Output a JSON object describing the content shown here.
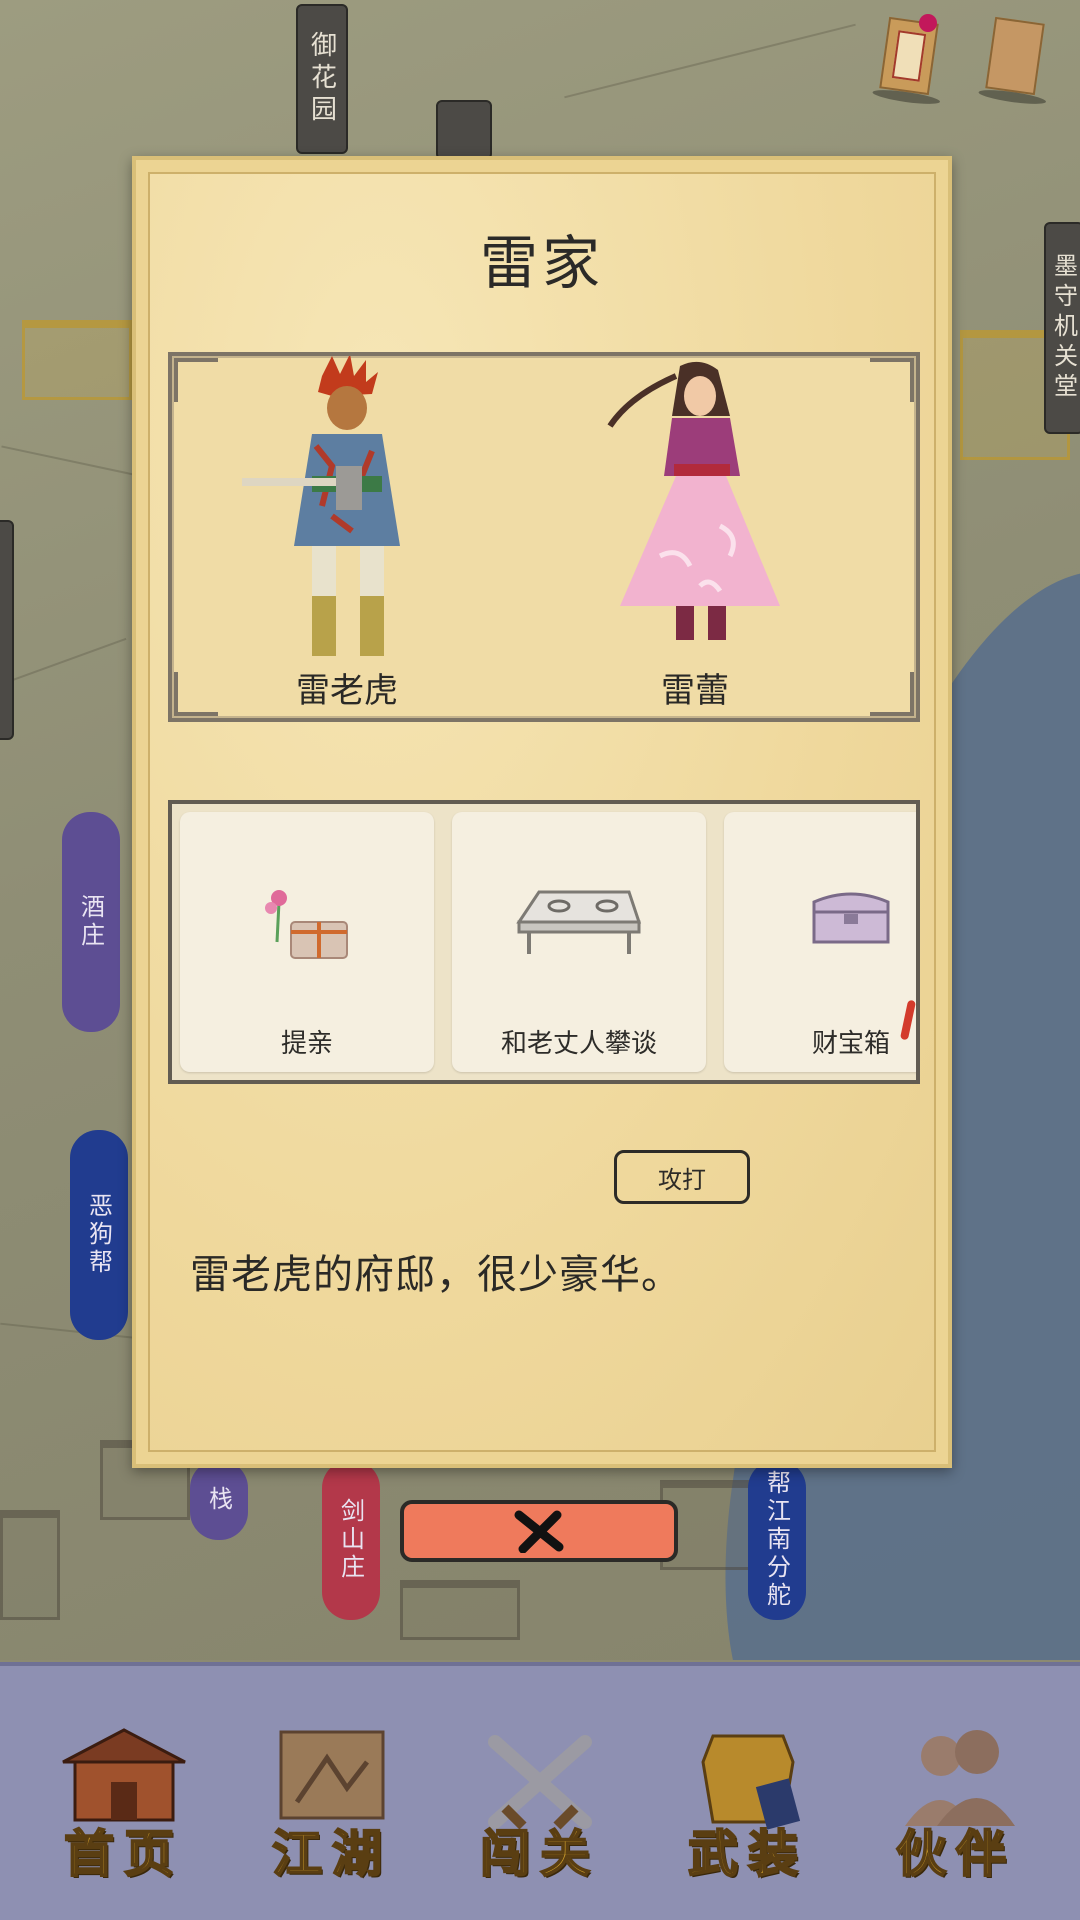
{
  "map": {
    "plaque_top": "御花园",
    "plaque_right": "墨守机关堂",
    "banners": {
      "jiuzhuang": "酒庄",
      "egoubang": "恶狗帮",
      "kezhan": "栈",
      "jianshanzhuang": "剑山庄",
      "jiangnanfenduo": "帮江南分舵"
    }
  },
  "dialog": {
    "title": "雷家",
    "npcs": [
      {
        "name": "雷老虎"
      },
      {
        "name": "雷蕾"
      }
    ],
    "actions": [
      {
        "label": "提亲",
        "icon": "gift-box-icon"
      },
      {
        "label": "和老丈人攀谈",
        "icon": "table-icon"
      },
      {
        "label": "财宝箱",
        "icon": "treasure-chest-icon"
      }
    ],
    "attack_label": "攻打",
    "description": "雷老虎的府邸，很少豪华。"
  },
  "bottom_nav": [
    {
      "label": "首页",
      "icon": "house-icon"
    },
    {
      "label": "江湖",
      "icon": "scroll-map-icon"
    },
    {
      "label": "闯关",
      "icon": "crossed-swords-icon"
    },
    {
      "label": "武装",
      "icon": "armor-icon"
    },
    {
      "label": "伙伴",
      "icon": "companions-icon"
    }
  ],
  "colors": {
    "dialog_bg": "#f1dda4",
    "close_button": "#ef7a5c",
    "nav_bg": "#8e90b2",
    "nav_label": "#c99a2b"
  }
}
